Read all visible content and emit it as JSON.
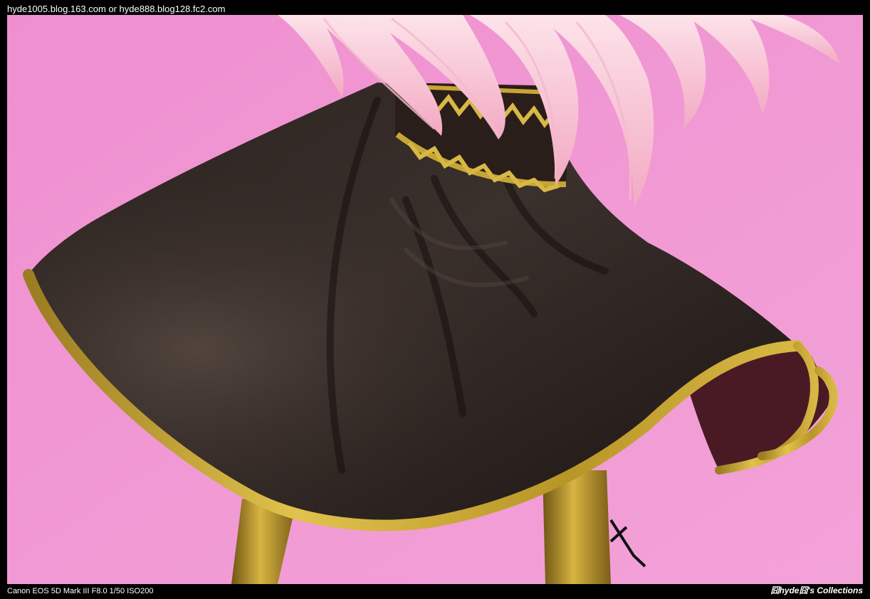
{
  "header": {
    "blog_urls": "hyde1005.blog.163.com or hyde888.blog128.fc2.com"
  },
  "footer": {
    "camera_info": "Canon EOS 5D Mark III  F8.0 1/50 ISO200",
    "watermark": "囧hyde囧's Collections"
  },
  "photo": {
    "subject": "figure-skirt-closeup",
    "colors": {
      "background": "#f095d2",
      "skirt": "#1f1714",
      "gold_trim": "#c7a534",
      "hair": "#f7c8d8"
    }
  }
}
